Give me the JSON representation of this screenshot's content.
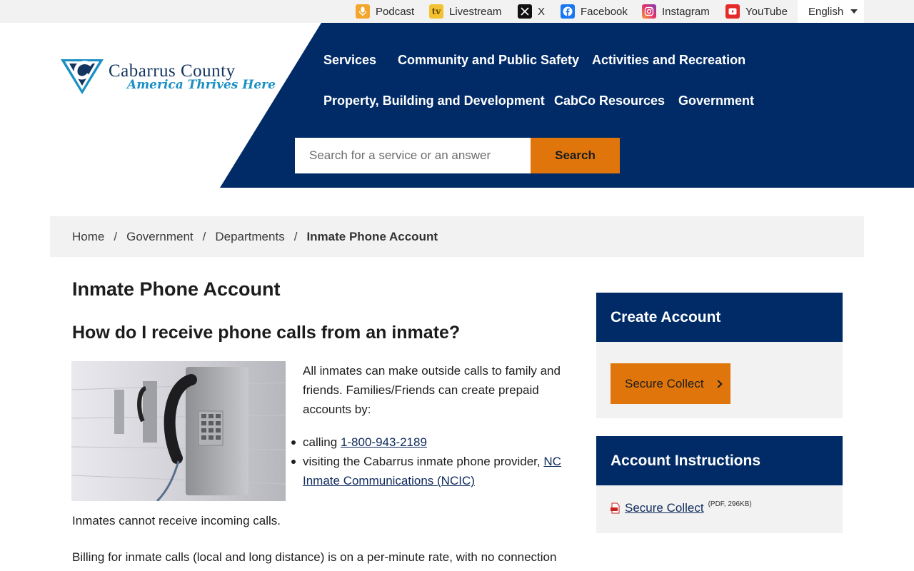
{
  "topbar": {
    "social": [
      {
        "label": "Podcast",
        "icon": "podcast-icon"
      },
      {
        "label": "Livestream",
        "icon": "livestream-icon"
      },
      {
        "label": "X",
        "icon": "x-icon"
      },
      {
        "label": "Facebook",
        "icon": "facebook-icon"
      },
      {
        "label": "Instagram",
        "icon": "instagram-icon"
      },
      {
        "label": "YouTube",
        "icon": "youtube-icon"
      }
    ],
    "language": "English"
  },
  "logo": {
    "title": "Cabarrus County",
    "tagline": "America Thrives Here"
  },
  "nav": {
    "items": [
      "Services",
      "Community and Public Safety",
      "Activities and Recreation",
      "Property, Building and Development",
      "CabCo Resources",
      "Government"
    ]
  },
  "search": {
    "placeholder": "Search for a service or an answer",
    "button": "Search"
  },
  "breadcrumb": {
    "items": [
      "Home",
      "Government",
      "Departments"
    ],
    "current": "Inmate Phone Account"
  },
  "main": {
    "title": "Inmate Phone Account",
    "question": "How do I receive phone calls from an inmate?",
    "intro": "All inmates can make outside calls to family and friends. Families/Friends can create prepaid accounts by:",
    "bullet1_prefix": "calling",
    "bullet1_link": "1-800-943-2189",
    "bullet2_prefix": "visiting the Cabarrus inmate phone provider,",
    "bullet2_link": "NC Inmate Communications (NCIC)",
    "incoming": "Inmates cannot receive incoming calls.",
    "billing": "Billing for inmate calls (local and long distance) is on a per-minute rate, with no connection"
  },
  "sidebar": {
    "create_title": "Create Account",
    "create_button": "Secure Collect",
    "instructions_title": "Account Instructions",
    "doc_link": "Secure Collect",
    "doc_meta": "(PDF, 296KB)"
  },
  "colors": {
    "navy": "#002b66",
    "orange": "#e0760b",
    "light_gray": "#f2f2f2"
  }
}
